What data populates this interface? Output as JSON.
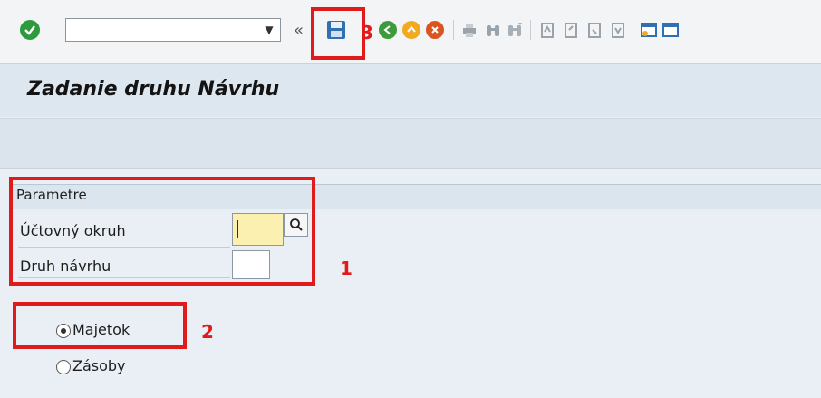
{
  "toolbar": {
    "command_field_value": "",
    "expand_glyph": "«",
    "icons": [
      "check-icon",
      "save-icon",
      "back-icon",
      "exit-icon",
      "cancel-icon",
      "print-icon",
      "find-icon",
      "find-next-icon",
      "first-page-icon",
      "previous-page-icon",
      "next-page-icon",
      "last-page-icon",
      "create-session-icon",
      "shortcut-icon"
    ]
  },
  "title": "Zadanie druhu Návrhu",
  "parameters": {
    "group_title": "Parametre",
    "company_code_label": "Účtovný okruh",
    "company_code_value": "",
    "proposal_type_label": "Druh návrhu",
    "proposal_type_value": ""
  },
  "options": {
    "assets_label": "Majetok",
    "inventory_label": "Zásoby",
    "selected": "Majetok"
  },
  "annotations": {
    "num1": "1",
    "num2": "2",
    "num3": "3",
    "color": "#e01b1b"
  }
}
